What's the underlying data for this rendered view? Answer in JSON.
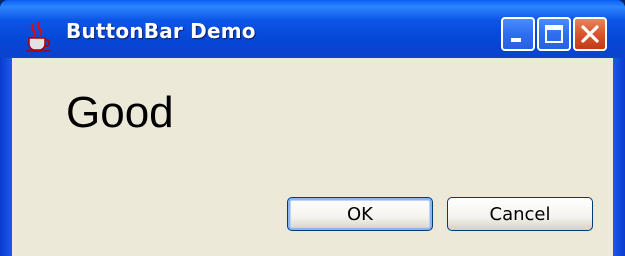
{
  "window": {
    "title": "ButtonBar Demo",
    "app_icon": "java-cup-icon",
    "controls": [
      "minimize-icon",
      "maximize-icon",
      "close-icon"
    ]
  },
  "content": {
    "message": "Good"
  },
  "buttons": {
    "ok_label": "OK",
    "cancel_label": "Cancel"
  },
  "colors": {
    "titlebar": "#0a4fdc",
    "client_background": "#ece9d8",
    "close_button": "#d9552c",
    "default_button_focus": "#8cb4f2"
  }
}
